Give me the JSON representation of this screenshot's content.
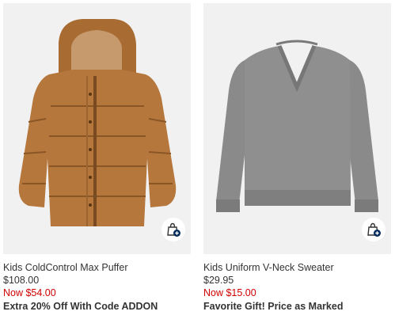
{
  "products": [
    {
      "name": "Kids ColdControl Max Puffer",
      "original_price": "$108.00",
      "sale_price": "Now $54.00",
      "promo": "Extra 20% Off With Code ADDON",
      "image_icon": "puffer-jacket-image",
      "add_icon": "quick-add-bag-icon"
    },
    {
      "name": "Kids Uniform V-Neck Sweater",
      "original_price": "$29.95",
      "sale_price": "Now $15.00",
      "promo": "Favorite Gift! Price as Marked",
      "image_icon": "v-neck-sweater-image",
      "add_icon": "quick-add-bag-icon"
    }
  ],
  "colors": {
    "sale_red": "#d00000",
    "text": "#333333",
    "image_bg": "#f1f1f1",
    "bag_badge": "#002b5c"
  }
}
